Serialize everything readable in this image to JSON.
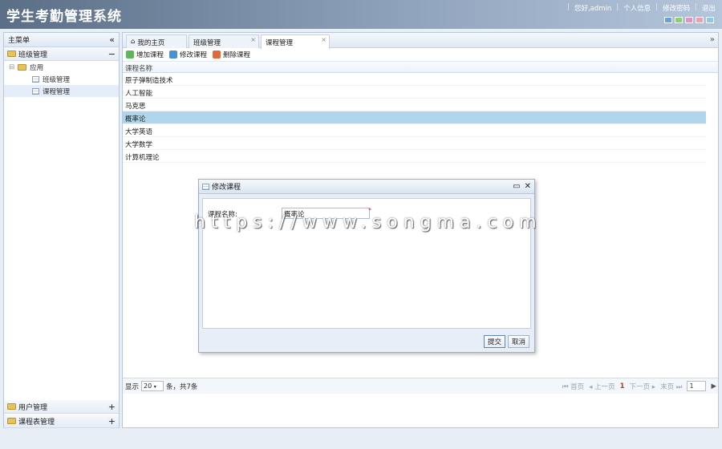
{
  "header": {
    "title": "学生考勤管理系统",
    "greeting": "您好,admin",
    "links": [
      "个人信息",
      "修改密码",
      "退出"
    ],
    "skins": [
      "#6aa0d8",
      "#8fd06a",
      "#e58ec8",
      "#e8a0b0",
      "#8cc8e8"
    ]
  },
  "sidebar": {
    "title": "主菜单",
    "collapse_icon": "«",
    "sections": [
      {
        "label": "班级管理",
        "toggle": "−"
      },
      {
        "label": "用户管理",
        "toggle": "+"
      },
      {
        "label": "课程表管理",
        "toggle": "+"
      }
    ],
    "tree": {
      "group": "应用",
      "expander": "⊟",
      "items": [
        "班级管理",
        "课程管理"
      ]
    }
  },
  "tabs": [
    {
      "label": "我的主页",
      "close": ""
    },
    {
      "label": "班级管理",
      "close": "×"
    },
    {
      "label": "课程管理",
      "close": "×"
    }
  ],
  "tab_scroll": "»",
  "toolbar": {
    "add": "增加课程",
    "edit": "修改课程",
    "delete": "删除课程",
    "colors": {
      "add": "#5cb85c",
      "edit": "#4a8fd0",
      "delete": "#e06a3c"
    }
  },
  "grid": {
    "column": "课程名称",
    "rows": [
      "原子弹制造技术",
      "人工智能",
      "马克思",
      "概率论",
      "大学英语",
      "大学数学",
      "计算机理论"
    ],
    "selected_index": 3
  },
  "pager": {
    "show": "显示",
    "page_size": "20",
    "suffix": "条，共7条",
    "first": "首页",
    "prev": "上一页",
    "current": "1",
    "next": "下一页",
    "last": "末页",
    "page_input": "1"
  },
  "dialog": {
    "title": "修改课程",
    "field_label": "课程名称:",
    "field_value": "概率论",
    "required": "*",
    "submit": "提交",
    "cancel": "取消",
    "max_icon": "▭",
    "close_icon": "✕"
  },
  "watermark": "https://www.songma.com"
}
